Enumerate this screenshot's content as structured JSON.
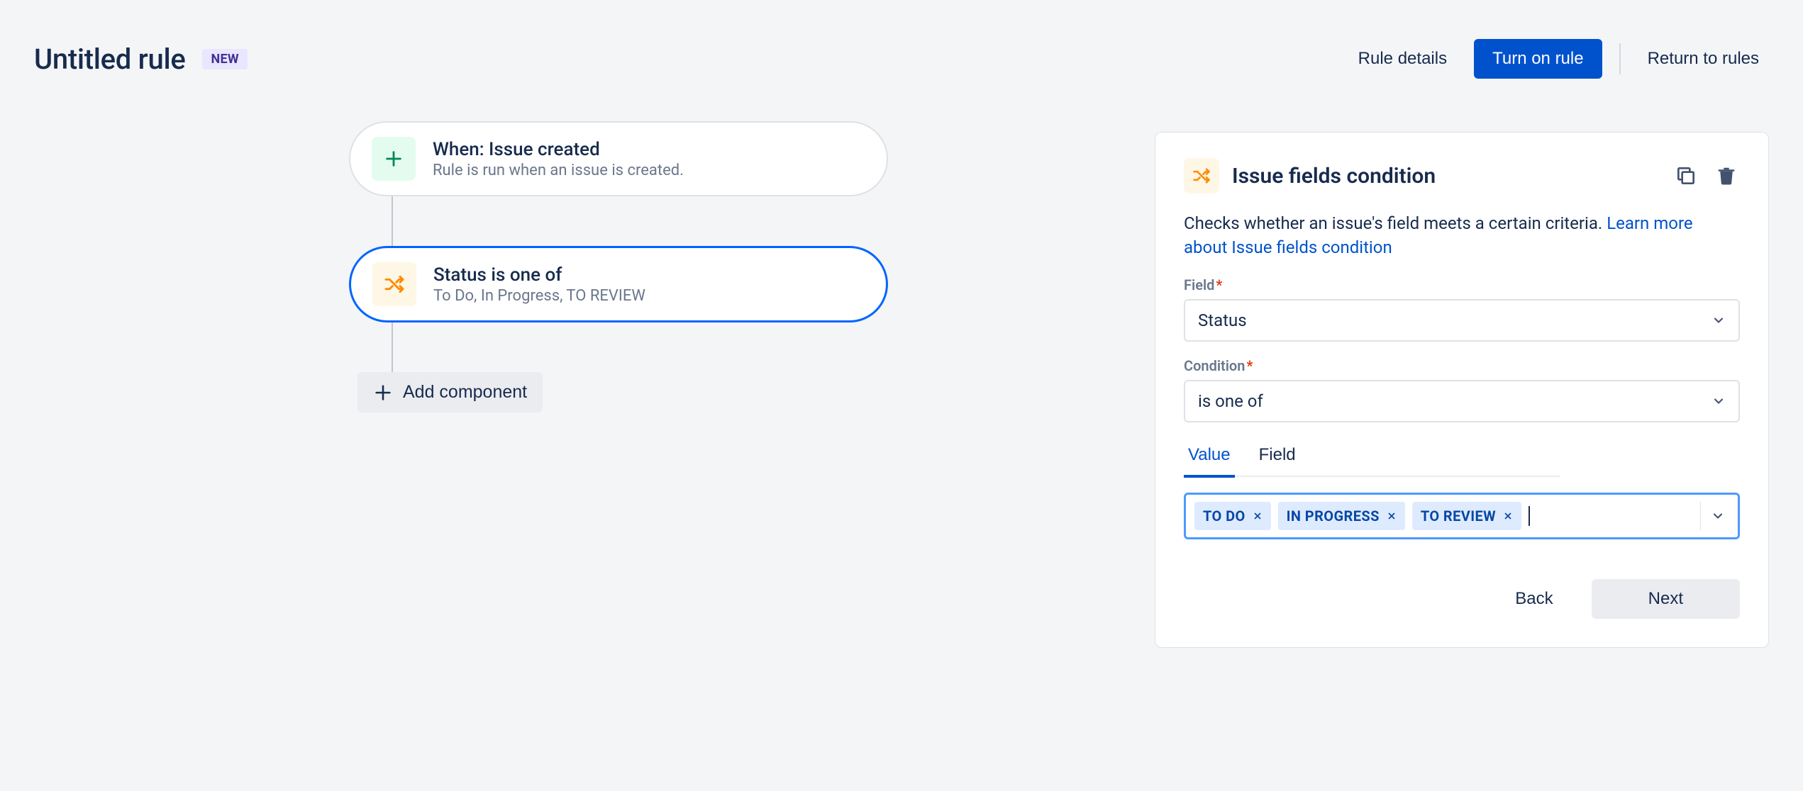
{
  "header": {
    "title": "Untitled rule",
    "badge": "NEW",
    "rule_details": "Rule details",
    "turn_on": "Turn on rule",
    "return": "Return to rules"
  },
  "nodes": {
    "trigger": {
      "title": "When: Issue created",
      "sub": "Rule is run when an issue is created."
    },
    "condition": {
      "title": "Status is one of",
      "sub": "To Do, In Progress, TO REVIEW"
    },
    "add_component": "Add component"
  },
  "panel": {
    "title": "Issue fields condition",
    "desc_prefix": "Checks whether an issue's field meets a certain criteria. ",
    "desc_link": "Learn more about Issue fields condition",
    "field_label": "Field",
    "field_value": "Status",
    "condition_label": "Condition",
    "condition_value": "is one of",
    "tabs": {
      "value": "Value",
      "field": "Field"
    },
    "chips": [
      "TO DO",
      "IN PROGRESS",
      "TO REVIEW"
    ],
    "back": "Back",
    "next": "Next"
  }
}
